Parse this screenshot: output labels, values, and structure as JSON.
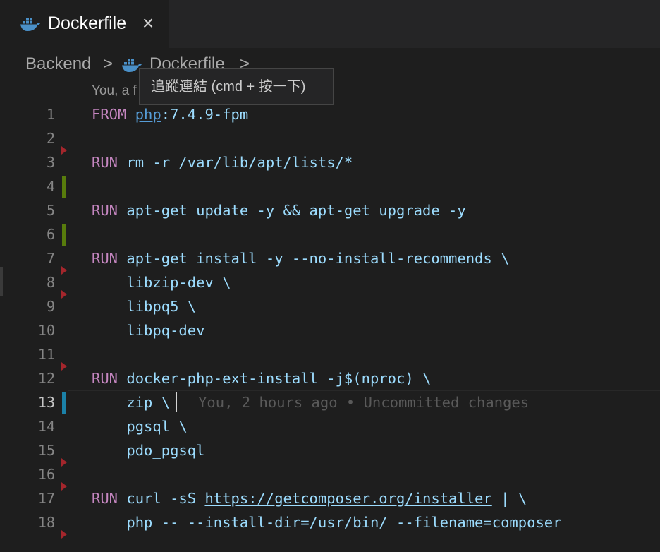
{
  "tab": {
    "label": "Dockerfile",
    "icon": "docker-icon",
    "close_icon": "close-icon"
  },
  "breadcrumb": {
    "folder": "Backend",
    "file": "Dockerfile",
    "separator": ">"
  },
  "tooltip": {
    "text": "追蹤連結 (cmd + 按一下)"
  },
  "blame_header": {
    "text": "You, a f                                          urt and others)"
  },
  "blame_inline": {
    "text": "You, 2 hours ago • Uncommitted changes"
  },
  "colors": {
    "keyword": "#c586c0",
    "identifier": "#9cdcfe",
    "link": "#569cd6",
    "added": "#587c0c",
    "modified": "#1b81a8",
    "deleted": "#a4262c"
  },
  "lines": [
    {
      "n": "1",
      "kw": "FROM",
      "img": "php",
      "rest": ":7.4.9-fpm"
    },
    {
      "n": "2"
    },
    {
      "n": "3",
      "kw": "RUN",
      "rest": " rm -r /var/lib/apt/lists/*"
    },
    {
      "n": "4"
    },
    {
      "n": "5",
      "kw": "RUN",
      "rest": " apt-get update -y && apt-get upgrade -y"
    },
    {
      "n": "6"
    },
    {
      "n": "7",
      "kw": "RUN",
      "rest": " apt-get install -y --no-install-recommends \\"
    },
    {
      "n": "8",
      "rest": "    libzip-dev \\"
    },
    {
      "n": "9",
      "rest": "    libpq5 \\"
    },
    {
      "n": "10",
      "rest": "    libpq-dev"
    },
    {
      "n": "11"
    },
    {
      "n": "12",
      "kw": "RUN",
      "rest": " docker-php-ext-install -j$(nproc) \\"
    },
    {
      "n": "13",
      "rest": "    zip \\"
    },
    {
      "n": "14",
      "rest": "    pgsql \\"
    },
    {
      "n": "15",
      "rest": "    pdo_pgsql"
    },
    {
      "n": "16"
    },
    {
      "n": "17",
      "kw": "RUN",
      "rest": " curl -sS ",
      "url": "https://getcomposer.org/installer",
      "tail": " | \\"
    },
    {
      "n": "18",
      "rest": "    php -- --install-dir=/usr/bin/ --filename=composer"
    }
  ]
}
